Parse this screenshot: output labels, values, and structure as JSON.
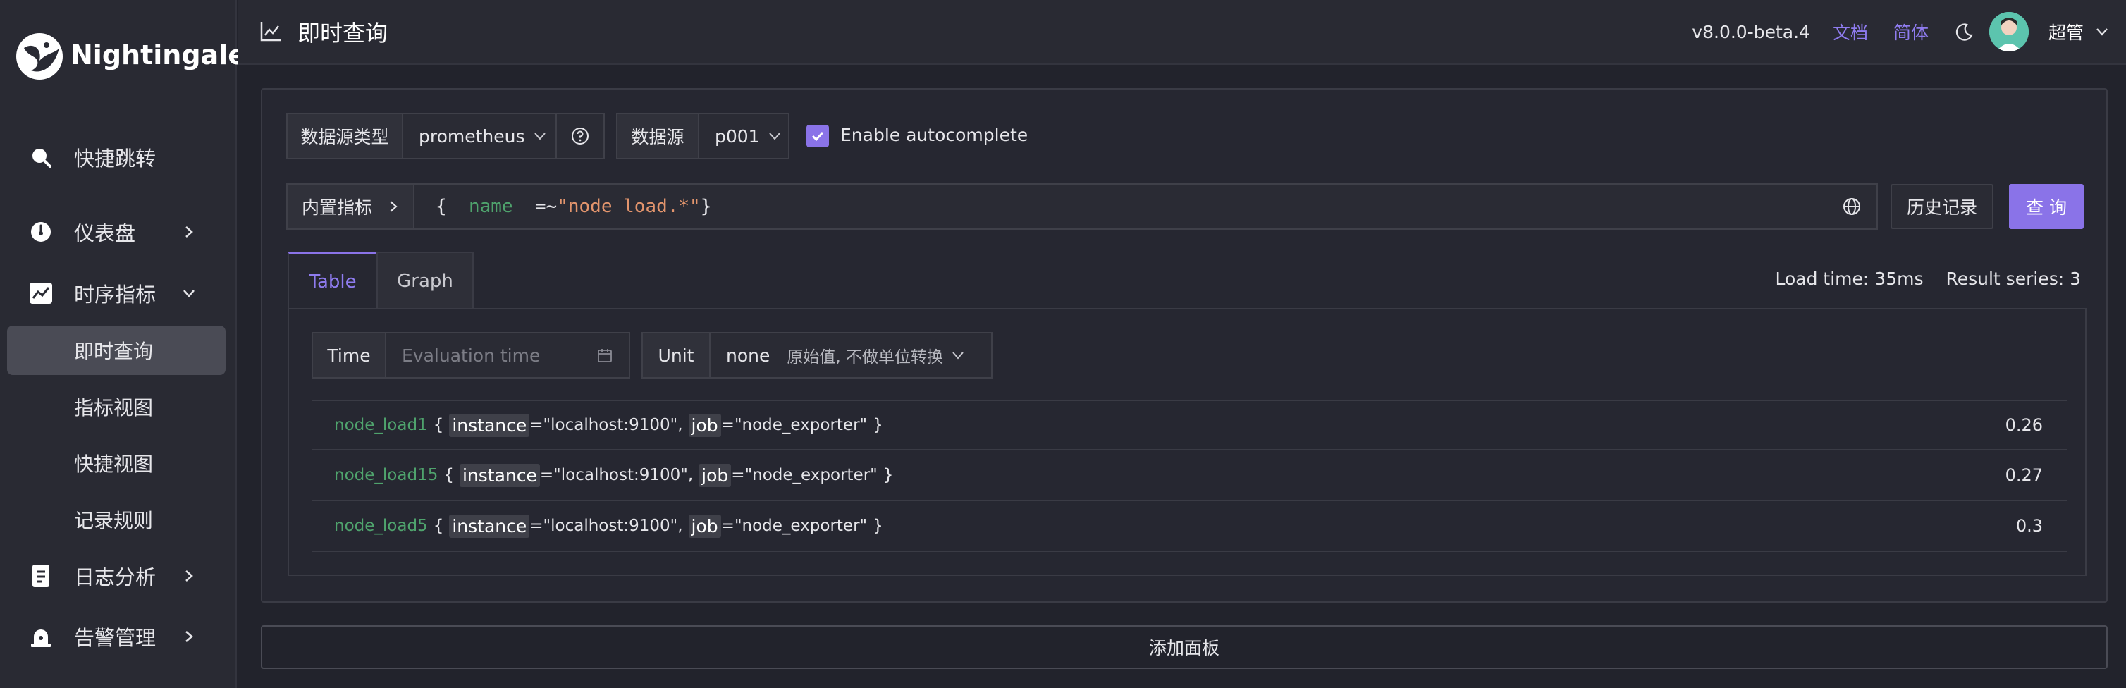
{
  "app": {
    "name": "Nightingale"
  },
  "sidebar": {
    "items": [
      {
        "label": "快捷跳转",
        "icon": "search-icon"
      },
      {
        "label": "仪表盘",
        "icon": "dashboard-icon"
      },
      {
        "label": "时序指标",
        "icon": "chart-icon"
      },
      {
        "label": "日志分析",
        "icon": "log-icon"
      },
      {
        "label": "告警管理",
        "icon": "alarm-icon"
      }
    ],
    "sub_items": [
      {
        "label": "即时查询",
        "active": true
      },
      {
        "label": "指标视图"
      },
      {
        "label": "快捷视图"
      },
      {
        "label": "记录规则"
      }
    ]
  },
  "header": {
    "title": "即时查询",
    "version": "v8.0.0-beta.4",
    "docs_link": "文档",
    "lang_link": "简体",
    "username": "超管"
  },
  "query": {
    "datasource_type_label": "数据源类型",
    "datasource_type_value": "prometheus",
    "datasource_label": "数据源",
    "datasource_value": "p001",
    "autocomplete_label": "Enable autocomplete",
    "autocomplete_checked": true,
    "builtin_metrics_label": "内置指标",
    "promql": {
      "open": "{",
      "name_key": "__name__",
      "op": "=~",
      "value": "\"node_load.*\"",
      "close": "}"
    },
    "history_button": "历史记录",
    "query_button": "查 询"
  },
  "tabs": [
    {
      "label": "Table",
      "active": true
    },
    {
      "label": "Graph",
      "active": false
    }
  ],
  "stats": {
    "load_time": "Load time: 35ms",
    "result_series": "Result series: 3"
  },
  "table_controls": {
    "time_label": "Time",
    "time_placeholder": "Evaluation time",
    "unit_label": "Unit",
    "unit_value": "none",
    "unit_desc": "原始值, 不做单位转换"
  },
  "results": [
    {
      "metric": "node_load1",
      "instance": "\"localhost:9100\"",
      "job": "\"node_exporter\"",
      "value": "0.26"
    },
    {
      "metric": "node_load15",
      "instance": "\"localhost:9100\"",
      "job": "\"node_exporter\"",
      "value": "0.27"
    },
    {
      "metric": "node_load5",
      "instance": "\"localhost:9100\"",
      "job": "\"node_exporter\"",
      "value": "0.3"
    }
  ],
  "label_keys": {
    "instance": "instance",
    "job": "job"
  },
  "add_panel_button": "添加面板",
  "colors": {
    "accent": "#8a73e8",
    "metric_green": "#4fa36d",
    "background": "#22232c"
  }
}
